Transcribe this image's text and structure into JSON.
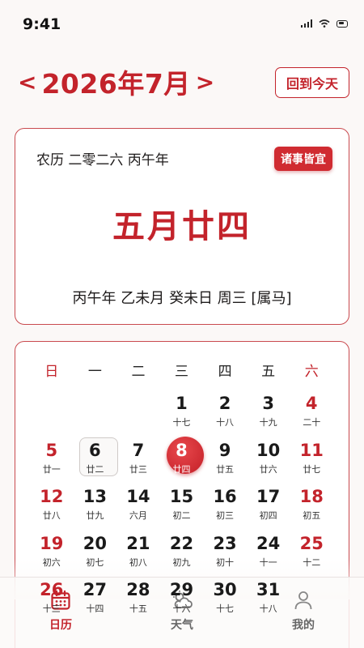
{
  "status_bar": {
    "time": "9:41"
  },
  "header": {
    "prev_arrow": "<",
    "month_title": "2026年7月",
    "next_arrow": ">",
    "today_button": "回到今天"
  },
  "lunar_card": {
    "lunar_year": "农历 二零二六 丙午年",
    "badge": "诸事皆宜",
    "lunar_day": "五月廿四",
    "ganzhi_line": "丙午年 乙未月 癸未日 周三 [属马]"
  },
  "calendar": {
    "weekdays": [
      "日",
      "一",
      "二",
      "三",
      "四",
      "五",
      "六"
    ],
    "rows": [
      [
        {
          "day": "",
          "lunar": ""
        },
        {
          "day": "",
          "lunar": ""
        },
        {
          "day": "",
          "lunar": ""
        },
        {
          "day": "1",
          "lunar": "十七"
        },
        {
          "day": "2",
          "lunar": "十八"
        },
        {
          "day": "3",
          "lunar": "十九"
        },
        {
          "day": "4",
          "lunar": "二十"
        }
      ],
      [
        {
          "day": "5",
          "lunar": "廿一"
        },
        {
          "day": "6",
          "lunar": "廿二"
        },
        {
          "day": "7",
          "lunar": "廿三"
        },
        {
          "day": "8",
          "lunar": "廿四"
        },
        {
          "day": "9",
          "lunar": "廿五"
        },
        {
          "day": "10",
          "lunar": "廿六"
        },
        {
          "day": "11",
          "lunar": "廿七"
        }
      ],
      [
        {
          "day": "12",
          "lunar": "廿八"
        },
        {
          "day": "13",
          "lunar": "廿九"
        },
        {
          "day": "14",
          "lunar": "六月"
        },
        {
          "day": "15",
          "lunar": "初二"
        },
        {
          "day": "16",
          "lunar": "初三"
        },
        {
          "day": "17",
          "lunar": "初四"
        },
        {
          "day": "18",
          "lunar": "初五"
        }
      ],
      [
        {
          "day": "19",
          "lunar": "初六"
        },
        {
          "day": "20",
          "lunar": "初七"
        },
        {
          "day": "21",
          "lunar": "初八"
        },
        {
          "day": "22",
          "lunar": "初九"
        },
        {
          "day": "23",
          "lunar": "初十"
        },
        {
          "day": "24",
          "lunar": "十一"
        },
        {
          "day": "25",
          "lunar": "十二"
        }
      ],
      [
        {
          "day": "26",
          "lunar": "十三"
        },
        {
          "day": "27",
          "lunar": "十四"
        },
        {
          "day": "28",
          "lunar": "十五"
        },
        {
          "day": "29",
          "lunar": "十六"
        },
        {
          "day": "30",
          "lunar": "十七"
        },
        {
          "day": "31",
          "lunar": "十八"
        },
        {
          "day": "",
          "lunar": ""
        }
      ]
    ]
  },
  "tab_bar": {
    "tabs": [
      {
        "label": "日历",
        "icon": "calendar-icon",
        "active": true
      },
      {
        "label": "天气",
        "icon": "weather-icon",
        "active": false
      },
      {
        "label": "我的",
        "icon": "user-icon",
        "active": false
      }
    ]
  },
  "colors": {
    "accent": "#c3232b",
    "background": "#fbf8f7"
  }
}
